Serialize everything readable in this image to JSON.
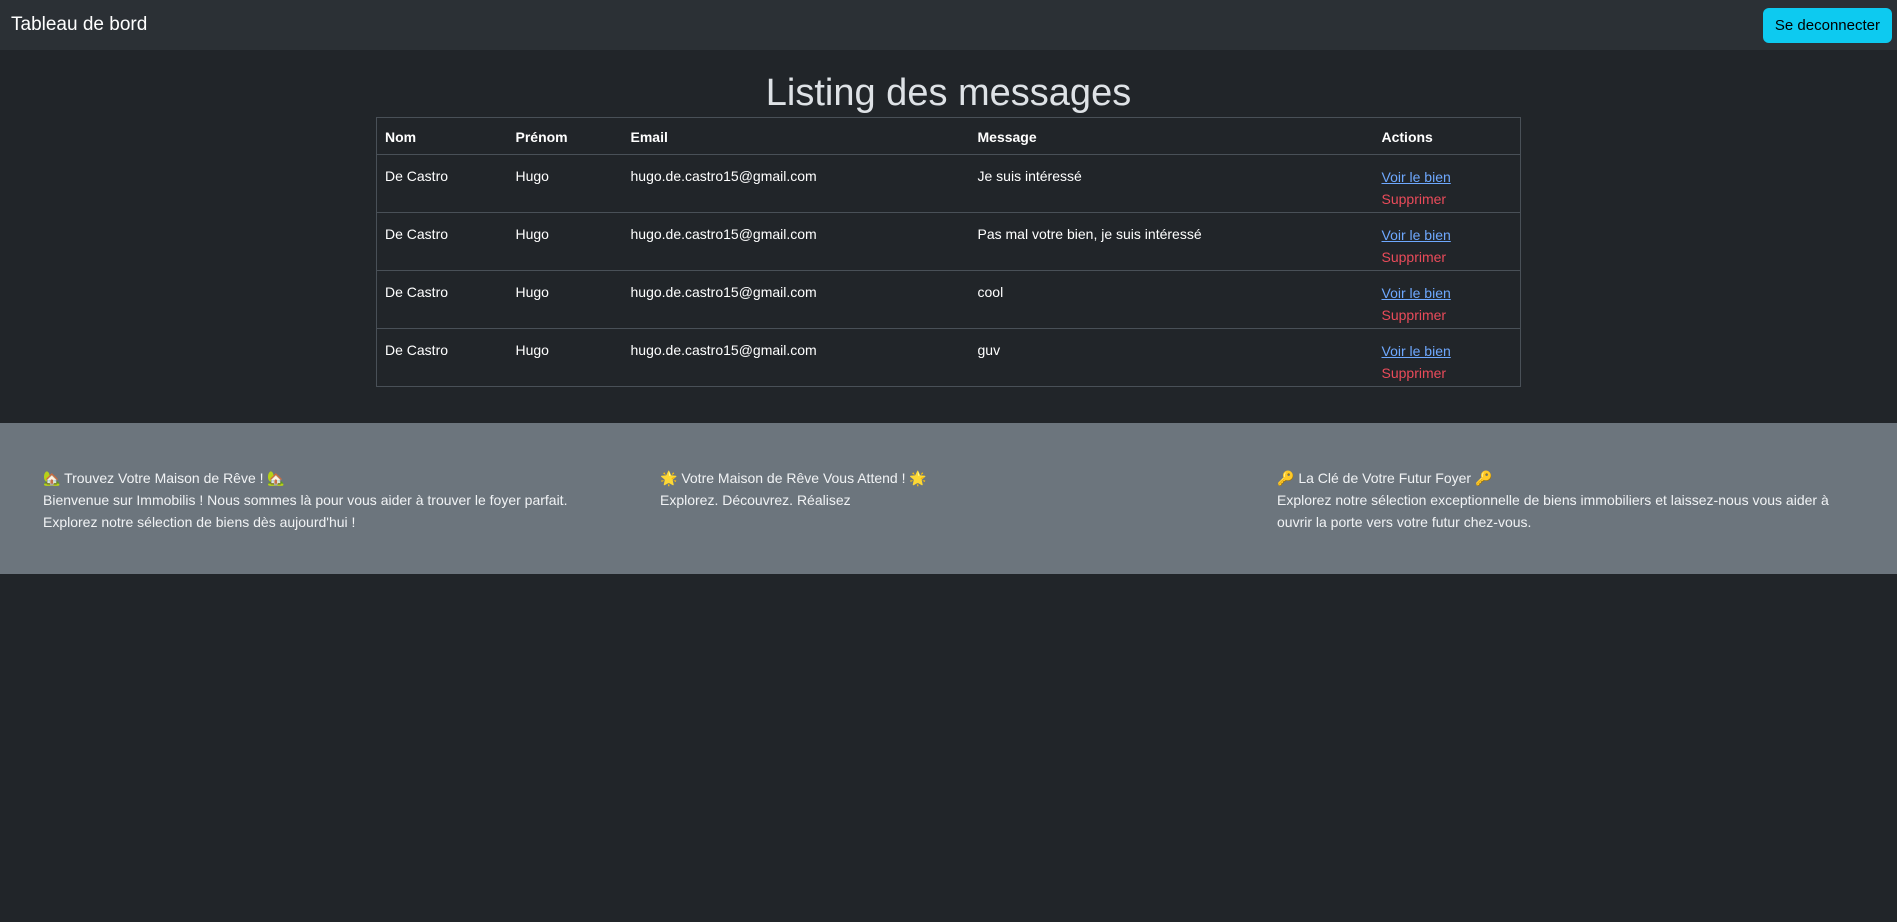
{
  "navbar": {
    "brand": "Tableau de bord",
    "logout_label": "Se deconnecter"
  },
  "page": {
    "title": "Listing des messages"
  },
  "table": {
    "headers": [
      "Nom",
      "Prénom",
      "Email",
      "Message",
      "Actions"
    ],
    "rows": [
      {
        "nom": "De Castro",
        "prenom": "Hugo",
        "email": "hugo.de.castro15@gmail.com",
        "message": "Je suis intéressé",
        "view_label": "Voir le bien",
        "delete_label": "Supprimer"
      },
      {
        "nom": "De Castro",
        "prenom": "Hugo",
        "email": "hugo.de.castro15@gmail.com",
        "message": "Pas mal votre bien, je suis intéressé",
        "view_label": "Voir le bien",
        "delete_label": "Supprimer"
      },
      {
        "nom": "De Castro",
        "prenom": "Hugo",
        "email": "hugo.de.castro15@gmail.com",
        "message": "cool",
        "view_label": "Voir le bien",
        "delete_label": "Supprimer"
      },
      {
        "nom": "De Castro",
        "prenom": "Hugo",
        "email": "hugo.de.castro15@gmail.com",
        "message": "guv",
        "view_label": "Voir le bien",
        "delete_label": "Supprimer"
      }
    ]
  },
  "footer": {
    "columns": [
      {
        "heading": "🏡 Trouvez Votre Maison de Rêve ! 🏡",
        "text": "Bienvenue sur Immobilis ! Nous sommes là pour vous aider à trouver le foyer parfait. Explorez notre sélection de biens dès aujourd'hui !"
      },
      {
        "heading": "🌟 Votre Maison de Rêve Vous Attend ! 🌟",
        "text": "Explorez. Découvrez. Réalisez"
      },
      {
        "heading": "🔑 La Clé de Votre Futur Foyer 🔑",
        "text": "Explorez notre sélection exceptionnelle de biens immobiliers et laissez-nous vous aider à ouvrir la porte vers votre futur chez-vous."
      }
    ]
  },
  "colors": {
    "background": "#212529",
    "navbar": "#2b3035",
    "accent_button": "#0dcaf0",
    "link": "#6ea8fe",
    "danger": "#ea4b5a",
    "footer": "#6c757d"
  }
}
